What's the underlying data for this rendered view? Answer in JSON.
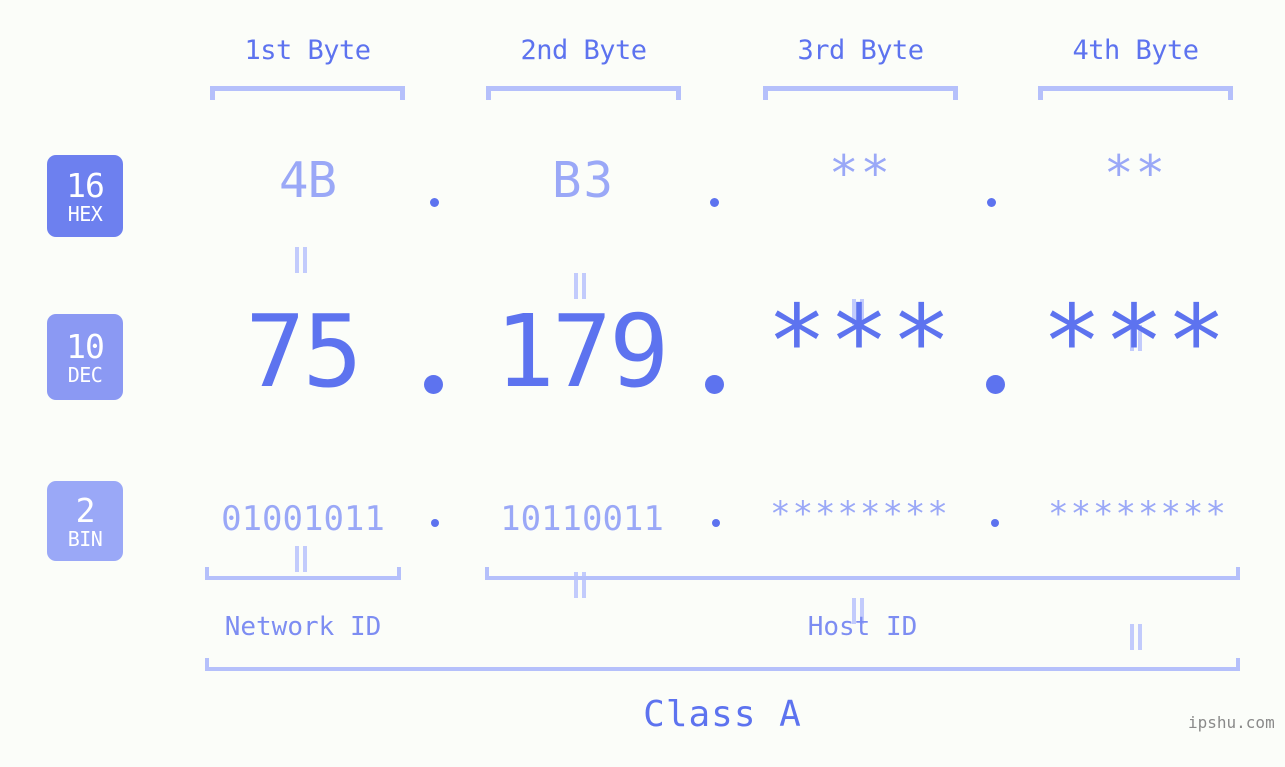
{
  "diagram": {
    "background_color": "#fbfdf9",
    "accent_color": "#5d73ef",
    "light_accent_color": "#9aa8f7",
    "bracket_color": "#b5c0fb",
    "byte_headers": [
      {
        "label": "1st Byte"
      },
      {
        "label": "2nd Byte"
      },
      {
        "label": "3rd Byte"
      },
      {
        "label": "4th Byte"
      }
    ],
    "rows": [
      {
        "badge_number": "16",
        "badge_label": "HEX",
        "badge_color": "#6d80ef",
        "values": [
          "4B",
          "B3",
          "**",
          "**"
        ],
        "separator": "."
      },
      {
        "badge_number": "10",
        "badge_label": "DEC",
        "badge_color": "#8b99f3",
        "values": [
          "75",
          "179",
          "***",
          "***"
        ],
        "separator": "."
      },
      {
        "badge_number": "2",
        "badge_label": "BIN",
        "badge_color": "#9aa8f7",
        "values": [
          "01001011",
          "10110011",
          "********",
          "********"
        ],
        "separator": "."
      }
    ],
    "equals_symbol": "=",
    "sections": [
      {
        "label": "Network ID"
      },
      {
        "label": "Host ID"
      }
    ],
    "class_label": "Class A",
    "watermark": "ipshu.com"
  }
}
